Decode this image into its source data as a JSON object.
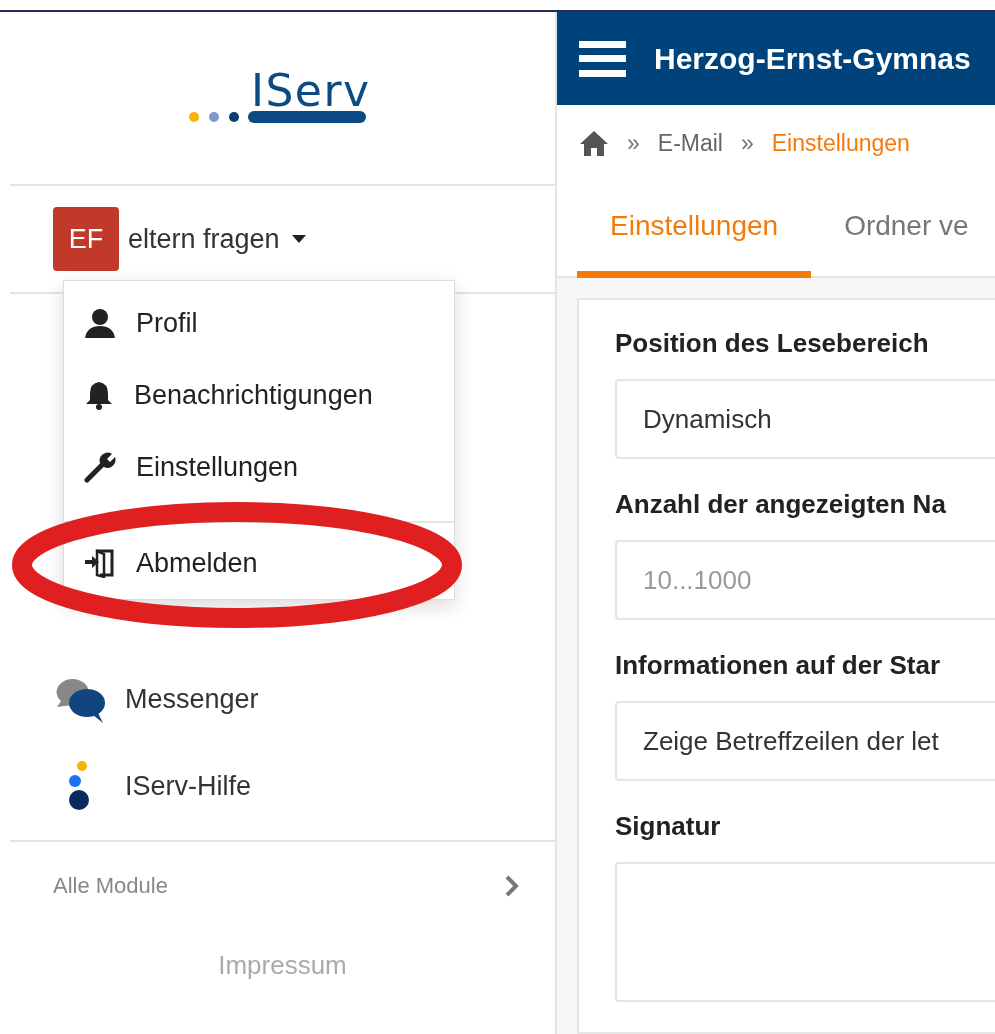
{
  "sidebar": {
    "logo": {
      "text": "IServ"
    },
    "user": {
      "initials": "EF",
      "name": "eltern fragen",
      "expanded": true
    },
    "items": [
      {
        "label": "Messenger",
        "kind": "messenger"
      },
      {
        "label": "IServ-Hilfe",
        "kind": "help"
      }
    ],
    "all_modules": "Alle Module",
    "footer": "Impressum"
  },
  "user_menu": {
    "items": [
      {
        "label": "Profil",
        "kind": "profile"
      },
      {
        "label": "Benachrichtigungen",
        "kind": "notifications"
      },
      {
        "label": "Einstellungen",
        "kind": "settings"
      },
      {
        "label": "Abmelden",
        "kind": "logout"
      }
    ]
  },
  "header": {
    "title": "Herzog-Ernst-Gymnas"
  },
  "breadcrumb": [
    {
      "label": "E-Mail",
      "selected": false
    },
    {
      "label": "Einstellungen",
      "selected": true
    }
  ],
  "breadcrumb_separator": "»",
  "tabs": [
    {
      "label": "Einstellungen",
      "selected": true
    },
    {
      "label": "Ordner ve",
      "selected": false
    }
  ],
  "form": [
    {
      "label": "Position des Lesebereich",
      "kind": "select",
      "value": "Dynamisch"
    },
    {
      "label": "Anzahl der angezeigten Na",
      "kind": "input",
      "placeholder": "10...1000"
    },
    {
      "label": "Informationen auf der Star",
      "kind": "select",
      "value": "Zeige Betreffzeilen der let"
    },
    {
      "label": "Signatur",
      "kind": "textarea"
    }
  ]
}
